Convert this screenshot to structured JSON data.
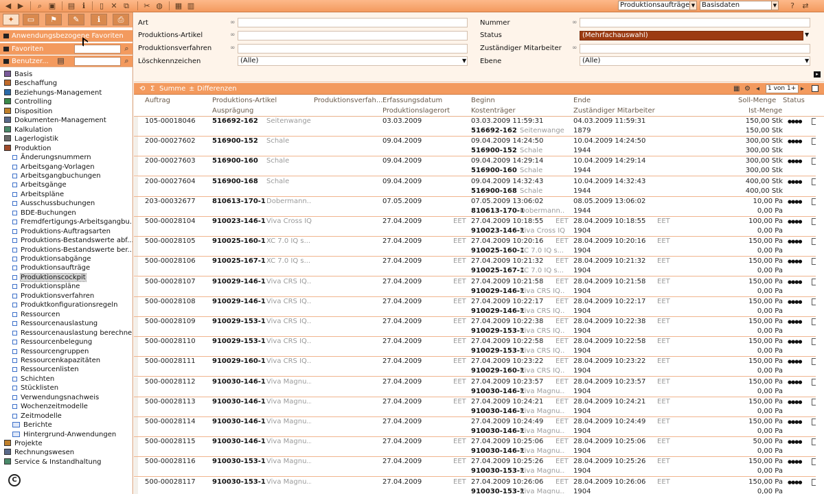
{
  "toolbar": {
    "icons": [
      "arrow-left-icon",
      "arrow-right-icon",
      "binoculars-icon",
      "folder-icon",
      "window-icon",
      "info-icon",
      "new-doc-icon",
      "delete-icon",
      "copy-icon",
      "tools-icon",
      "globe-icon",
      "calculator-icon",
      "chart-icon",
      "help-icon"
    ],
    "select_context": "Produktionsaufträge",
    "select_view": "Basisdaten"
  },
  "sidebar": {
    "tab_icons": [
      "star-icon",
      "window-icon",
      "flag-icon",
      "tools-icon",
      "info-icon",
      "print-icon"
    ],
    "bars": [
      "Anwendungsbezogene Favoriten",
      "Favoriten",
      "Benutzer..."
    ],
    "tree": [
      {
        "label": "Basis",
        "level": 0,
        "icon": "book-icon"
      },
      {
        "label": "Beschaffung",
        "level": 0,
        "icon": "cart-icon"
      },
      {
        "label": "Beziehungs-Management",
        "level": 0,
        "icon": "people-icon"
      },
      {
        "label": "Controlling",
        "level": 0,
        "icon": "chart-icon"
      },
      {
        "label": "Disposition",
        "level": 0,
        "icon": "pallet-icon"
      },
      {
        "label": "Dokumenten-Management",
        "level": 0,
        "icon": "document-icon"
      },
      {
        "label": "Kalkulation",
        "level": 0,
        "icon": "calculator-icon"
      },
      {
        "label": "Lagerlogistik",
        "level": 0,
        "icon": "shelf-icon"
      },
      {
        "label": "Produktion",
        "level": 0,
        "icon": "factory-icon"
      },
      {
        "label": "Änderungsnummern",
        "level": 1
      },
      {
        "label": "Arbeitsgang-Vorlagen",
        "level": 1
      },
      {
        "label": "Arbeitsgangbuchungen",
        "level": 1
      },
      {
        "label": "Arbeitsgänge",
        "level": 1
      },
      {
        "label": "Arbeitspläne",
        "level": 1
      },
      {
        "label": "Ausschussbuchungen",
        "level": 1
      },
      {
        "label": "BDE-Buchungen",
        "level": 1
      },
      {
        "label": "Fremdfertigungs-Arbeitsgangbu...",
        "level": 1
      },
      {
        "label": "Produktions-Auftragsarten",
        "level": 1
      },
      {
        "label": "Produktions-Bestandswerte abf...",
        "level": 1
      },
      {
        "label": "Produktions-Bestandswerte ber...",
        "level": 1
      },
      {
        "label": "Produktionsabgänge",
        "level": 1
      },
      {
        "label": "Produktionsaufträge",
        "level": 1
      },
      {
        "label": "Produktionscockpit",
        "level": 1,
        "selected": true
      },
      {
        "label": "Produktionspläne",
        "level": 1
      },
      {
        "label": "Produktionsverfahren",
        "level": 1
      },
      {
        "label": "Produktkonfigurationsregeln",
        "level": 1
      },
      {
        "label": "Ressourcen",
        "level": 1
      },
      {
        "label": "Ressourcenauslastung",
        "level": 1
      },
      {
        "label": "Ressourcenauslastung berechnen",
        "level": 1
      },
      {
        "label": "Ressourcenbelegung",
        "level": 1
      },
      {
        "label": "Ressourcengruppen",
        "level": 1
      },
      {
        "label": "Ressourcenkapazitäten",
        "level": 1
      },
      {
        "label": "Ressourcenlisten",
        "level": 1
      },
      {
        "label": "Schichten",
        "level": 1
      },
      {
        "label": "Stücklisten",
        "level": 1
      },
      {
        "label": "Verwendungsnachweis",
        "level": 1
      },
      {
        "label": "Wochenzeitmodelle",
        "level": 1
      },
      {
        "label": "Zeitmodelle",
        "level": 1
      },
      {
        "label": "Berichte",
        "level": 2,
        "icon": "folder-icon"
      },
      {
        "label": "Hintergrund-Anwendungen",
        "level": 2,
        "icon": "folder-icon"
      },
      {
        "label": "Projekte",
        "level": 0,
        "icon": "project-icon"
      },
      {
        "label": "Rechnungswesen",
        "level": 0,
        "icon": "ledger-icon"
      },
      {
        "label": "Service & Instandhaltung",
        "level": 0,
        "icon": "wrench-icon"
      }
    ]
  },
  "filters": {
    "left": [
      {
        "label": "Art",
        "value": ""
      },
      {
        "label": "Produktions-Artikel",
        "value": ""
      },
      {
        "label": "Produktionsverfahren",
        "value": ""
      },
      {
        "label": "Löschkennzeichen",
        "value": "(Alle)"
      }
    ],
    "right": [
      {
        "label": "Nummer",
        "value": ""
      },
      {
        "label": "Status",
        "value": "(Mehrfachauswahl)"
      },
      {
        "label": "Zuständiger Mitarbeiter",
        "value": ""
      },
      {
        "label": "Ebene",
        "value": "(Alle)"
      }
    ],
    "infinity": "∞"
  },
  "gridbar": {
    "summe": "Summe",
    "differenzen": "Differenzen",
    "pager": "1 von 1+"
  },
  "columns": {
    "row1": [
      "Auftrag",
      "Produktions-Artikel",
      "Produktionsverfah...",
      "Erfassungsdatum",
      "Beginn",
      "Ende",
      "Soll-Menge",
      "Status"
    ],
    "row2": [
      "Ausprägung",
      "Produktionslagerort",
      "Kostenträger",
      "Zuständiger Mitarbeiter",
      "Ist-Menge"
    ]
  },
  "rows": [
    {
      "auftrag": "105-00018046",
      "art": "516692-162",
      "artdesc": "Seitenwange ...",
      "erfassung": "03.03.2009",
      "tz1": "",
      "beginn": "03.03.2009 11:59:31",
      "tz2": "",
      "ende": "04.03.2009 11:59:31",
      "tz3": "",
      "soll": "150,00 Stk",
      "kt": "516692-162",
      "ktdesc": "Seitenwange ...",
      "ma": "1879",
      "ist": "150,00 Stk"
    },
    {
      "auftrag": "200-00027602",
      "art": "516900-152",
      "artdesc": "Schale",
      "erfassung": "09.04.2009",
      "tz1": "",
      "beginn": "09.04.2009 14:24:50",
      "tz2": "",
      "ende": "10.04.2009 14:24:50",
      "tz3": "",
      "soll": "300,00 Stk",
      "kt": "516900-152",
      "ktdesc": "Schale",
      "ma": "1944",
      "ist": "300,00 Stk"
    },
    {
      "auftrag": "200-00027603",
      "art": "516900-160",
      "artdesc": "Schale",
      "erfassung": "09.04.2009",
      "tz1": "",
      "beginn": "09.04.2009 14:29:14",
      "tz2": "",
      "ende": "10.04.2009 14:29:14",
      "tz3": "",
      "soll": "300,00 Stk",
      "kt": "516900-160",
      "ktdesc": "Schale",
      "ma": "1944",
      "ist": "300,00 Stk"
    },
    {
      "auftrag": "200-00027604",
      "art": "516900-168",
      "artdesc": "Schale",
      "erfassung": "09.04.2009",
      "tz1": "",
      "beginn": "09.04.2009 14:32:43",
      "tz2": "",
      "ende": "10.04.2009 14:32:43",
      "tz3": "",
      "soll": "400,00 Stk",
      "kt": "516900-168",
      "ktdesc": "Schale",
      "ma": "1944",
      "ist": "400,00 Stk"
    },
    {
      "auftrag": "203-00032677",
      "art": "810613-170-1",
      "artdesc": "Dobermann...",
      "erfassung": "07.05.2009",
      "tz1": "",
      "beginn": "07.05.2009 13:06:02",
      "tz2": "",
      "ende": "08.05.2009 13:06:02",
      "tz3": "",
      "soll": "10,00 Pa",
      "kt": "810613-170-1",
      "ktdesc": "Dobermann...",
      "ma": "1944",
      "ist": "0,00 Pa"
    },
    {
      "auftrag": "500-00028104",
      "art": "910023-146-1",
      "artdesc": "Viva Cross IQ",
      "erfassung": "27.04.2009",
      "tz1": "EET",
      "beginn": "27.04.2009 10:18:55",
      "tz2": "EET",
      "ende": "28.04.2009 10:18:55",
      "tz3": "EET",
      "soll": "100,00 Pa",
      "kt": "910023-146-1",
      "ktdesc": "Viva Cross IQ",
      "ma": "1904",
      "ist": "0,00 Pa"
    },
    {
      "auftrag": "500-00028105",
      "art": "910025-160-1",
      "artdesc": "XC 7.0 IQ s...",
      "erfassung": "27.04.2009",
      "tz1": "EET",
      "beginn": "27.04.2009 10:20:16",
      "tz2": "EET",
      "ende": "28.04.2009 10:20:16",
      "tz3": "EET",
      "soll": "150,00 Pa",
      "kt": "910025-160-1",
      "ktdesc": "XC 7.0 IQ s...",
      "ma": "1904",
      "ist": "0,00 Pa"
    },
    {
      "auftrag": "500-00028106",
      "art": "910025-167-1",
      "artdesc": "XC 7.0 IQ s...",
      "erfassung": "27.04.2009",
      "tz1": "EET",
      "beginn": "27.04.2009 10:21:32",
      "tz2": "EET",
      "ende": "28.04.2009 10:21:32",
      "tz3": "EET",
      "soll": "150,00 Pa",
      "kt": "910025-167-1",
      "ktdesc": "XC 7.0 IQ s...",
      "ma": "1904",
      "ist": "0,00 Pa"
    },
    {
      "auftrag": "500-00028107",
      "art": "910029-146-1",
      "artdesc": "Viva CRS IQ...",
      "erfassung": "27.04.2009",
      "tz1": "EET",
      "beginn": "27.04.2009 10:21:58",
      "tz2": "EET",
      "ende": "28.04.2009 10:21:58",
      "tz3": "EET",
      "soll": "150,00 Pa",
      "kt": "910029-146-1",
      "ktdesc": "Viva CRS IQ...",
      "ma": "1904",
      "ist": "0,00 Pa"
    },
    {
      "auftrag": "500-00028108",
      "art": "910029-146-1",
      "artdesc": "Viva CRS IQ...",
      "erfassung": "27.04.2009",
      "tz1": "EET",
      "beginn": "27.04.2009 10:22:17",
      "tz2": "EET",
      "ende": "28.04.2009 10:22:17",
      "tz3": "EET",
      "soll": "150,00 Pa",
      "kt": "910029-146-1",
      "ktdesc": "Viva CRS IQ...",
      "ma": "1904",
      "ist": "0,00 Pa"
    },
    {
      "auftrag": "500-00028109",
      "art": "910029-153-1",
      "artdesc": "Viva CRS IQ...",
      "erfassung": "27.04.2009",
      "tz1": "EET",
      "beginn": "27.04.2009 10:22:38",
      "tz2": "EET",
      "ende": "28.04.2009 10:22:38",
      "tz3": "EET",
      "soll": "150,00 Pa",
      "kt": "910029-153-1",
      "ktdesc": "Viva CRS IQ...",
      "ma": "1904",
      "ist": "0,00 Pa"
    },
    {
      "auftrag": "500-00028110",
      "art": "910029-153-1",
      "artdesc": "Viva CRS IQ...",
      "erfassung": "27.04.2009",
      "tz1": "EET",
      "beginn": "27.04.2009 10:22:58",
      "tz2": "EET",
      "ende": "28.04.2009 10:22:58",
      "tz3": "EET",
      "soll": "150,00 Pa",
      "kt": "910029-153-1",
      "ktdesc": "Viva CRS IQ...",
      "ma": "1904",
      "ist": "0,00 Pa"
    },
    {
      "auftrag": "500-00028111",
      "art": "910029-160-1",
      "artdesc": "Viva CRS IQ...",
      "erfassung": "27.04.2009",
      "tz1": "EET",
      "beginn": "27.04.2009 10:23:22",
      "tz2": "EET",
      "ende": "28.04.2009 10:23:22",
      "tz3": "EET",
      "soll": "150,00 Pa",
      "kt": "910029-160-1",
      "ktdesc": "Viva CRS IQ...",
      "ma": "1904",
      "ist": "0,00 Pa"
    },
    {
      "auftrag": "500-00028112",
      "art": "910030-146-1",
      "artdesc": "Viva Magnu...",
      "erfassung": "27.04.2009",
      "tz1": "EET",
      "beginn": "27.04.2009 10:23:57",
      "tz2": "EET",
      "ende": "28.04.2009 10:23:57",
      "tz3": "EET",
      "soll": "150,00 Pa",
      "kt": "910030-146-1",
      "ktdesc": "Viva Magnu...",
      "ma": "1904",
      "ist": "0,00 Pa"
    },
    {
      "auftrag": "500-00028113",
      "art": "910030-146-1",
      "artdesc": "Viva Magnu...",
      "erfassung": "27.04.2009",
      "tz1": "EET",
      "beginn": "27.04.2009 10:24:21",
      "tz2": "EET",
      "ende": "28.04.2009 10:24:21",
      "tz3": "EET",
      "soll": "150,00 Pa",
      "kt": "910030-146-1",
      "ktdesc": "Viva Magnu...",
      "ma": "1904",
      "ist": "0,00 Pa"
    },
    {
      "auftrag": "500-00028114",
      "art": "910030-146-1",
      "artdesc": "Viva Magnu...",
      "erfassung": "27.04.2009",
      "tz1": "",
      "beginn": "27.04.2009 10:24:49",
      "tz2": "EET",
      "ende": "28.04.2009 10:24:49",
      "tz3": "EET",
      "soll": "150,00 Pa",
      "kt": "910030-146-1",
      "ktdesc": "Viva Magnu...",
      "ma": "1904",
      "ist": "0,00 Pa"
    },
    {
      "auftrag": "500-00028115",
      "art": "910030-146-1",
      "artdesc": "Viva Magnu...",
      "erfassung": "27.04.2009",
      "tz1": "EET",
      "beginn": "27.04.2009 10:25:06",
      "tz2": "EET",
      "ende": "28.04.2009 10:25:06",
      "tz3": "EET",
      "soll": "50,00 Pa",
      "kt": "910030-146-1",
      "ktdesc": "Viva Magnu...",
      "ma": "1904",
      "ist": "0,00 Pa"
    },
    {
      "auftrag": "500-00028116",
      "art": "910030-153-1",
      "artdesc": "Viva Magnu...",
      "erfassung": "27.04.2009",
      "tz1": "EET",
      "beginn": "27.04.2009 10:25:26",
      "tz2": "EET",
      "ende": "28.04.2009 10:25:26",
      "tz3": "EET",
      "soll": "150,00 Pa",
      "kt": "910030-153-1",
      "ktdesc": "Viva Magnu...",
      "ma": "1904",
      "ist": "0,00 Pa"
    },
    {
      "auftrag": "500-00028117",
      "art": "910030-153-1",
      "artdesc": "Viva Magnu...",
      "erfassung": "27.04.2009",
      "tz1": "EET",
      "beginn": "27.04.2009 10:26:06",
      "tz2": "EET",
      "ende": "28.04.2009 10:26:06",
      "tz3": "EET",
      "soll": "150,00 Pa",
      "kt": "910030-153-1",
      "ktdesc": "Viva Magnu...",
      "ma": "1904",
      "ist": "0,00 Pa"
    }
  ],
  "status_glyph": "●●●●",
  "colors": {
    "accent": "#f39a5e",
    "status_red": "#9c3b12",
    "tree_blue": "#3b6fc9"
  }
}
